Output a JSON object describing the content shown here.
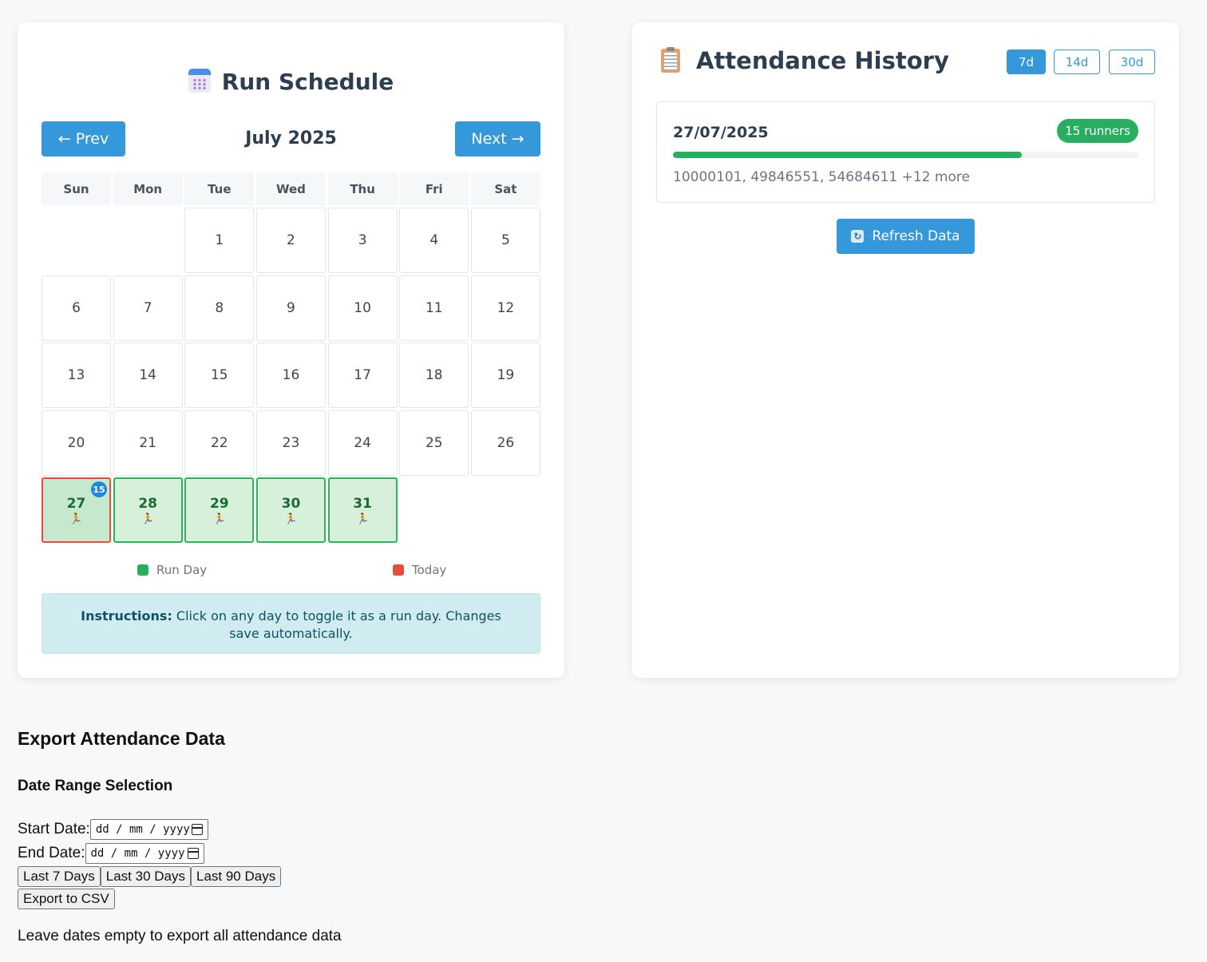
{
  "schedule": {
    "title": "Run Schedule",
    "icon": "calendar-icon",
    "prev_label": "← Prev",
    "next_label": "Next →",
    "month_label": "July 2025",
    "weekdays": [
      "Sun",
      "Mon",
      "Tue",
      "Wed",
      "Thu",
      "Fri",
      "Sat"
    ],
    "leading_blanks": 2,
    "days": [
      {
        "num": "1"
      },
      {
        "num": "2"
      },
      {
        "num": "3"
      },
      {
        "num": "4"
      },
      {
        "num": "5"
      },
      {
        "num": "6"
      },
      {
        "num": "7"
      },
      {
        "num": "8"
      },
      {
        "num": "9"
      },
      {
        "num": "10"
      },
      {
        "num": "11"
      },
      {
        "num": "12"
      },
      {
        "num": "13"
      },
      {
        "num": "14"
      },
      {
        "num": "15"
      },
      {
        "num": "16"
      },
      {
        "num": "17"
      },
      {
        "num": "18"
      },
      {
        "num": "19"
      },
      {
        "num": "20"
      },
      {
        "num": "21"
      },
      {
        "num": "22"
      },
      {
        "num": "23"
      },
      {
        "num": "24"
      },
      {
        "num": "25"
      },
      {
        "num": "26"
      },
      {
        "num": "27",
        "run": true,
        "today": true,
        "badge": "15",
        "marker": "🏃"
      },
      {
        "num": "28",
        "run": true,
        "marker": "🏃"
      },
      {
        "num": "29",
        "run": true,
        "marker": "🏃"
      },
      {
        "num": "30",
        "run": true,
        "marker": "🏃"
      },
      {
        "num": "31",
        "run": true,
        "marker": "🏃"
      }
    ],
    "legend": {
      "run_day": "Run Day",
      "today": "Today"
    },
    "instructions_bold": "Instructions:",
    "instructions_text": " Click on any day to toggle it as a run day. Changes save automatically."
  },
  "colors": {
    "accent": "#3498db",
    "run_green": "#27ae60",
    "today_red": "#e74c3c",
    "badge_blue": "#1e88e5"
  },
  "history": {
    "title": "Attendance History",
    "icon": "clipboard-icon",
    "ranges": [
      {
        "label": "7d",
        "active": true
      },
      {
        "label": "14d",
        "active": false
      },
      {
        "label": "30d",
        "active": false
      }
    ],
    "entries": [
      {
        "date": "27/07/2025",
        "runners_label": "15 runners",
        "fill_fraction": 0.75,
        "ids": "10000101, 49846551, 54684611 +12 more"
      }
    ],
    "refresh_label": "Refresh Data",
    "refresh_icon": "refresh-icon"
  },
  "export": {
    "title": "Export Attendance Data",
    "subtitle": "Date Range Selection",
    "start_label": "Start Date:",
    "end_label": "End Date:",
    "date_placeholder": "dd / mm / yyyy",
    "quick_buttons": [
      "Last 7 Days",
      "Last 30 Days",
      "Last 90 Days"
    ],
    "csv_label": "Export to CSV",
    "hint": "Leave dates empty to export all attendance data"
  }
}
